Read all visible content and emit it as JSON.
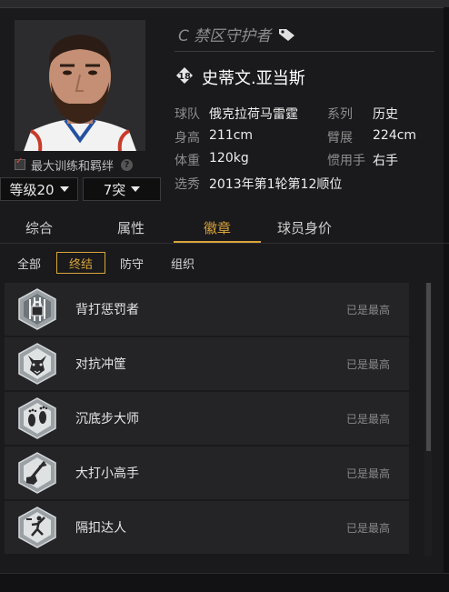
{
  "player": {
    "position": "C 禁区守护者",
    "jersey": "18",
    "name": "史蒂文.亚当斯",
    "info": {
      "team_label": "球队",
      "team": "俄克拉荷马雷霆",
      "series_label": "系列",
      "series": "历史",
      "height_label": "身高",
      "height": "211cm",
      "wingspan_label": "臂展",
      "wingspan": "224cm",
      "weight_label": "体重",
      "weight": "120kg",
      "hand_label": "惯用手",
      "hand": "右手",
      "draft_label": "选秀",
      "draft": "2013年第1轮第12顺位"
    }
  },
  "controls": {
    "max_train_label": "最大训练和羁绊",
    "help": "?",
    "level_value": "等级20",
    "break_value": "7突"
  },
  "tabs": [
    "综合",
    "属性",
    "徽章",
    "球员身价"
  ],
  "active_tab": "徽章",
  "subtabs": [
    "全部",
    "终结",
    "防守",
    "组织"
  ],
  "active_subtab": "终结",
  "badges": [
    {
      "name": "背打惩罚者",
      "status": "已是最高",
      "icon": "prison-bars-lock-icon"
    },
    {
      "name": "对抗冲筐",
      "status": "已是最高",
      "icon": "dog-head-icon"
    },
    {
      "name": "沉底步大师",
      "status": "已是最高",
      "icon": "footprints-icon"
    },
    {
      "name": "大打小高手",
      "status": "已是最高",
      "icon": "hand-holding-bar-icon"
    },
    {
      "name": "隔扣达人",
      "status": "已是最高",
      "icon": "dunking-player-icon"
    }
  ],
  "colors": {
    "accent": "#d9a43a",
    "background": "#1a1a1c",
    "row": "#242427"
  }
}
